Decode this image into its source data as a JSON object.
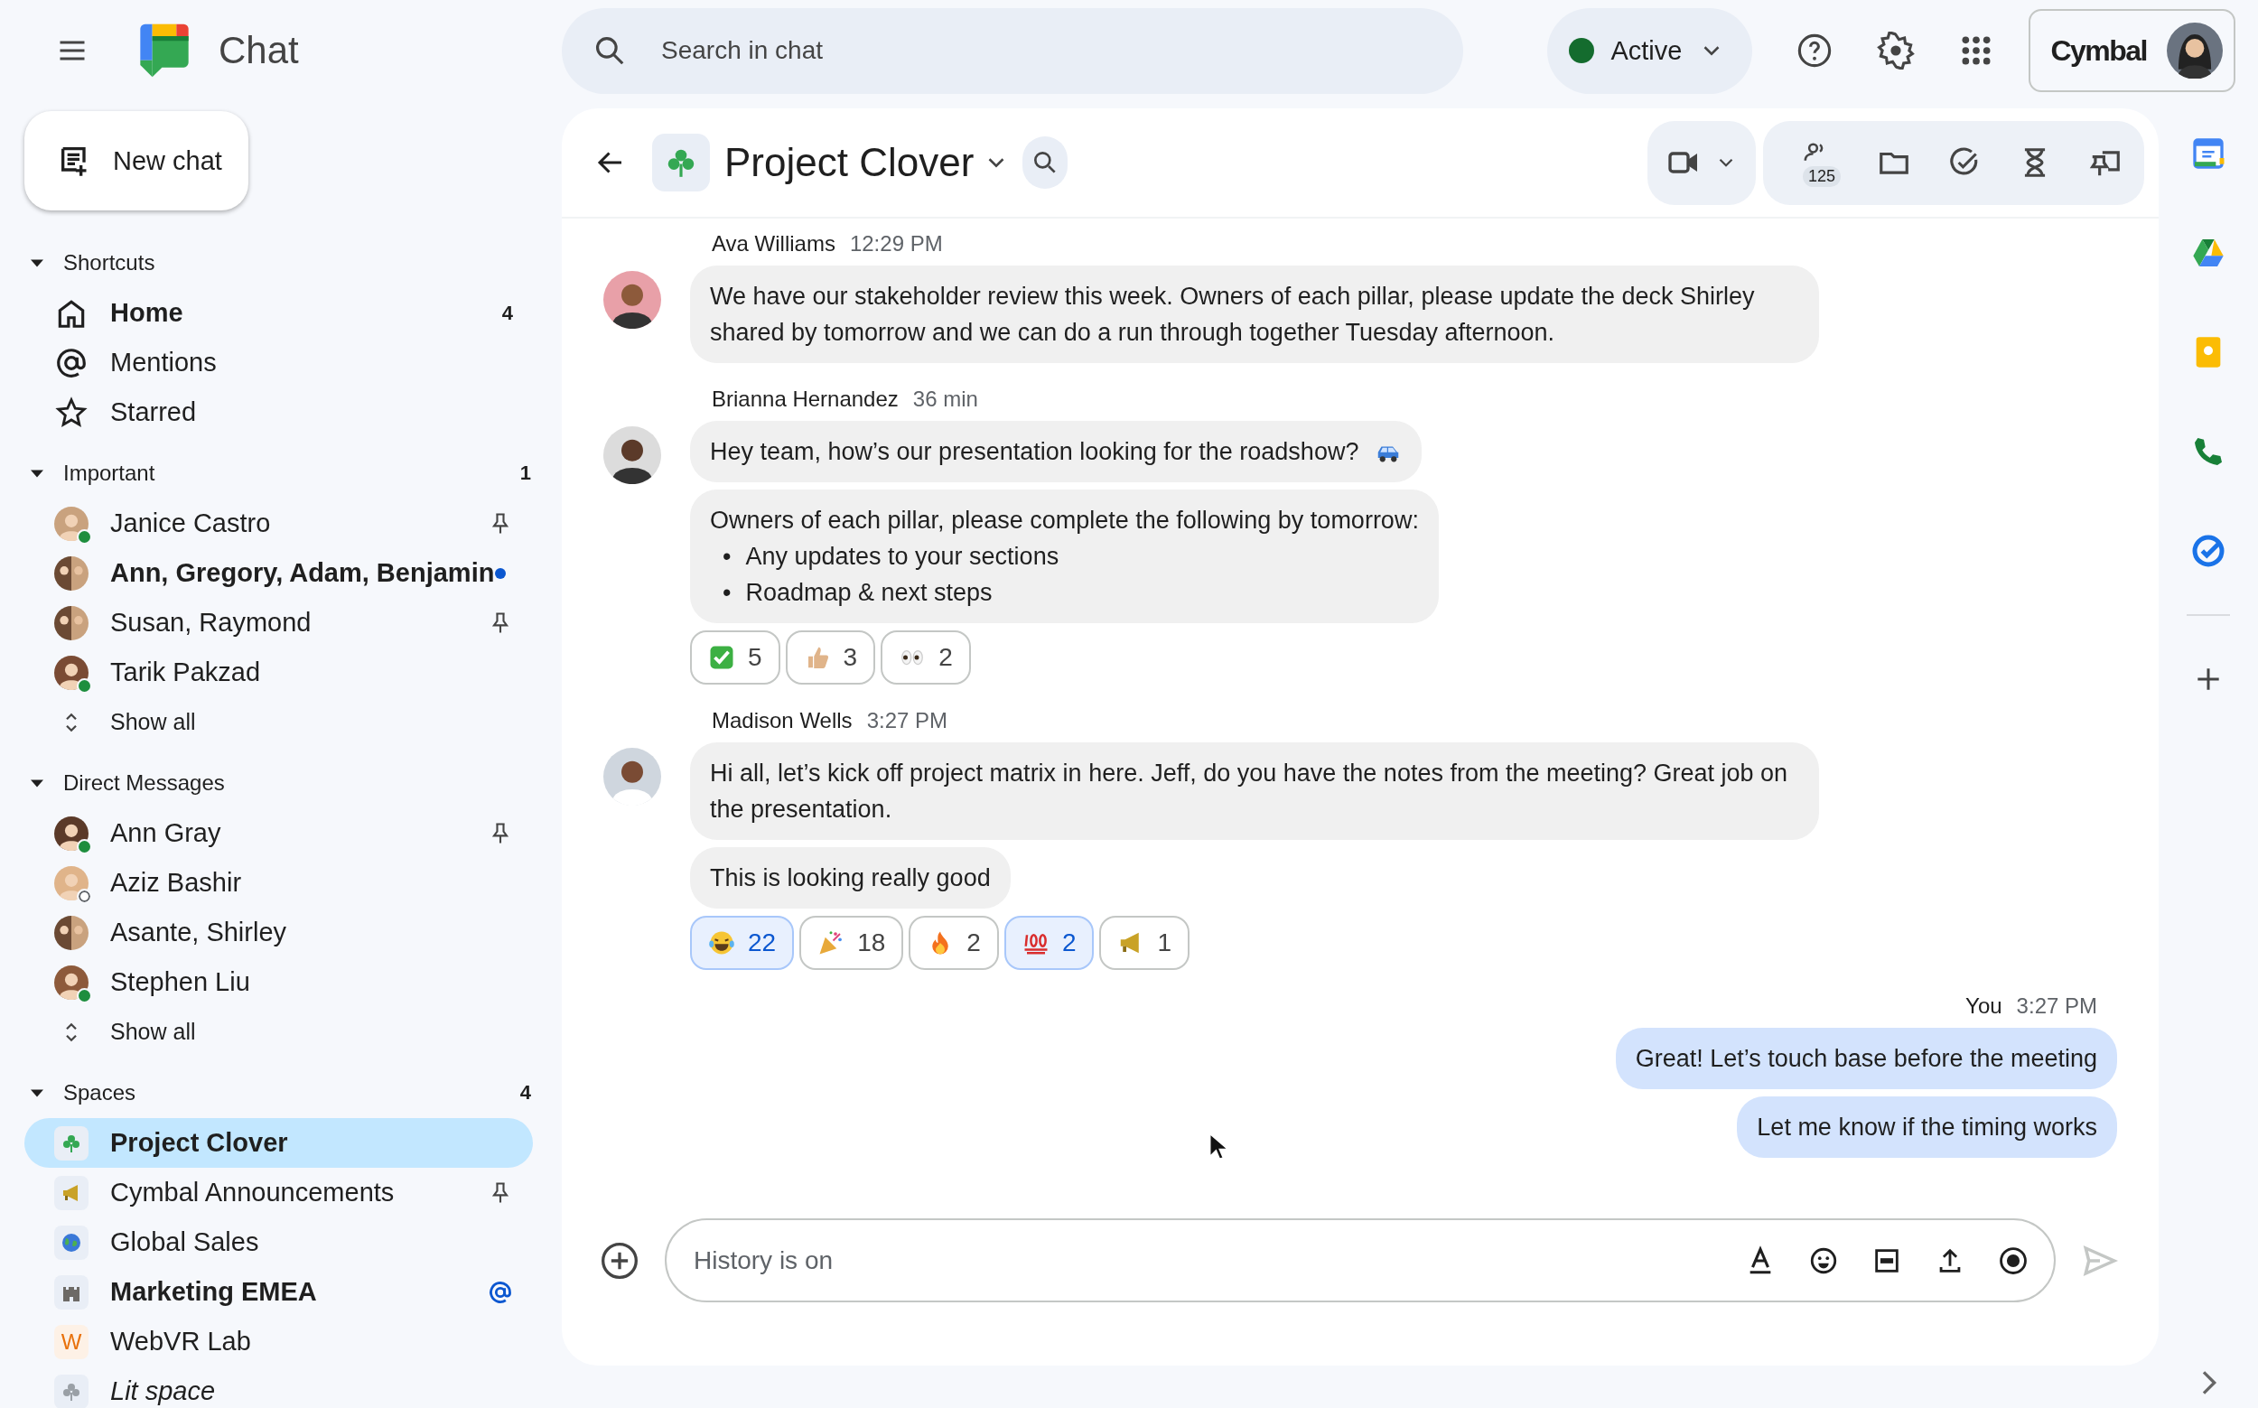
{
  "topbar": {
    "app_name": "Chat",
    "search": {
      "placeholder": "Search in chat"
    },
    "status": {
      "label": "Active",
      "available": true
    },
    "account": {
      "brand": "Cymbal"
    }
  },
  "sidebar": {
    "new_chat": "New chat",
    "sections": [
      {
        "title": "Shortcuts",
        "expanded": true,
        "items": [
          {
            "kind": "nav",
            "label": "Home",
            "bold": true,
            "pinned": false,
            "count": "4",
            "selected": false
          },
          {
            "kind": "nav",
            "label": "Mentions",
            "bold": false,
            "pinned": false,
            "selected": false
          },
          {
            "kind": "nav",
            "label": "Starred",
            "bold": false,
            "pinned": false,
            "selected": false
          }
        ]
      },
      {
        "title": "Important",
        "expanded": true,
        "count": "1",
        "items": [
          {
            "kind": "person",
            "label": "Janice Castro",
            "bold": false,
            "online": true,
            "pinned": true,
            "selected": false
          },
          {
            "kind": "group",
            "label": "Ann, Gregory, Adam, Benjamin",
            "bold": true,
            "unread": true,
            "pinned": false,
            "selected": false
          },
          {
            "kind": "group",
            "label": "Susan, Raymond",
            "bold": false,
            "pinned": true,
            "selected": false
          },
          {
            "kind": "person",
            "label": "Tarik Pakzad",
            "bold": false,
            "online": true,
            "pinned": false,
            "selected": false
          },
          {
            "kind": "show_all",
            "label": "Show all"
          }
        ]
      },
      {
        "title": "Direct Messages",
        "expanded": true,
        "items": [
          {
            "kind": "person",
            "label": "Ann Gray",
            "bold": false,
            "online": true,
            "pinned": true,
            "selected": false
          },
          {
            "kind": "person",
            "label": "Aziz Bashir",
            "bold": false,
            "online": false,
            "pinned": false,
            "selected": false
          },
          {
            "kind": "group",
            "label": "Asante, Shirley",
            "bold": false,
            "pinned": false,
            "selected": false
          },
          {
            "kind": "person",
            "label": "Stephen Liu",
            "bold": false,
            "online": true,
            "pinned": false,
            "selected": false
          },
          {
            "kind": "show_all",
            "label": "Show all"
          }
        ]
      },
      {
        "title": "Spaces",
        "expanded": true,
        "count": "4",
        "items": [
          {
            "kind": "space",
            "label": "Project Clover",
            "bold": true,
            "pinned": false,
            "selected": true
          },
          {
            "kind": "space",
            "label": "Cymbal Announcements",
            "bold": false,
            "pinned": true,
            "selected": false
          },
          {
            "kind": "space",
            "label": "Global Sales",
            "bold": false,
            "pinned": false,
            "selected": false
          },
          {
            "kind": "space",
            "label": "Marketing EMEA",
            "bold": true,
            "mentioned": true,
            "pinned": false,
            "selected": false
          },
          {
            "kind": "space",
            "initial": "W",
            "label": "WebVR Lab",
            "bold": false,
            "pinned": false,
            "selected": false
          },
          {
            "kind": "space",
            "label": "Lit space",
            "bold": false,
            "italic": true,
            "pinned": false,
            "selected": false
          }
        ]
      }
    ]
  },
  "conversation": {
    "title": "Project Clover",
    "member_count": "125",
    "groups": [
      {
        "sender": "Ava Williams",
        "time": "12:29 PM",
        "outgoing": false,
        "messages": [
          {
            "text": "We have our stakeholder review this week.  Owners of each pillar, please update the deck Shirley shared by tomorrow and we can do a run through together Tuesday afternoon."
          }
        ]
      },
      {
        "sender": "Brianna Hernandez",
        "time": "36 min",
        "outgoing": false,
        "messages": [
          {
            "text": "Hey team, how’s our presentation looking for the roadshow?",
            "car_emoji": true
          },
          {
            "text": "Owners of each pillar, please complete the following by tomorrow:",
            "bullets": [
              {
                "marker": "•",
                "text": "Any updates to your sections"
              },
              {
                "marker": "•",
                "text": "Roadmap & next steps"
              }
            ]
          }
        ],
        "reactions": [
          {
            "kind": "check",
            "count": "5",
            "selected": false
          },
          {
            "kind": "thumbs_up",
            "count": "3",
            "selected": false
          },
          {
            "kind": "eyes",
            "count": "2",
            "selected": false
          }
        ]
      },
      {
        "sender": "Madison Wells",
        "time": "3:27 PM",
        "outgoing": false,
        "messages": [
          {
            "text": "Hi all, let’s kick off project matrix in here. Jeff, do you have the notes from the meeting? Great job on the presentation."
          },
          {
            "text": "This is looking really good"
          }
        ],
        "reactions": [
          {
            "kind": "laugh",
            "count": "22",
            "selected": true
          },
          {
            "kind": "party",
            "count": "18",
            "selected": false
          },
          {
            "kind": "fire",
            "count": "2",
            "selected": false
          },
          {
            "kind": "hundred",
            "count": "2",
            "selected": true
          },
          {
            "kind": "megaphone",
            "count": "1",
            "selected": false
          }
        ]
      },
      {
        "sender": "You",
        "time": "3:27 PM",
        "outgoing": true,
        "messages": [
          {
            "text": "Great! Let’s touch base before the meeting"
          },
          {
            "text": "Let me know if the timing works"
          }
        ]
      }
    ]
  },
  "composer": {
    "placeholder": "History is on"
  }
}
